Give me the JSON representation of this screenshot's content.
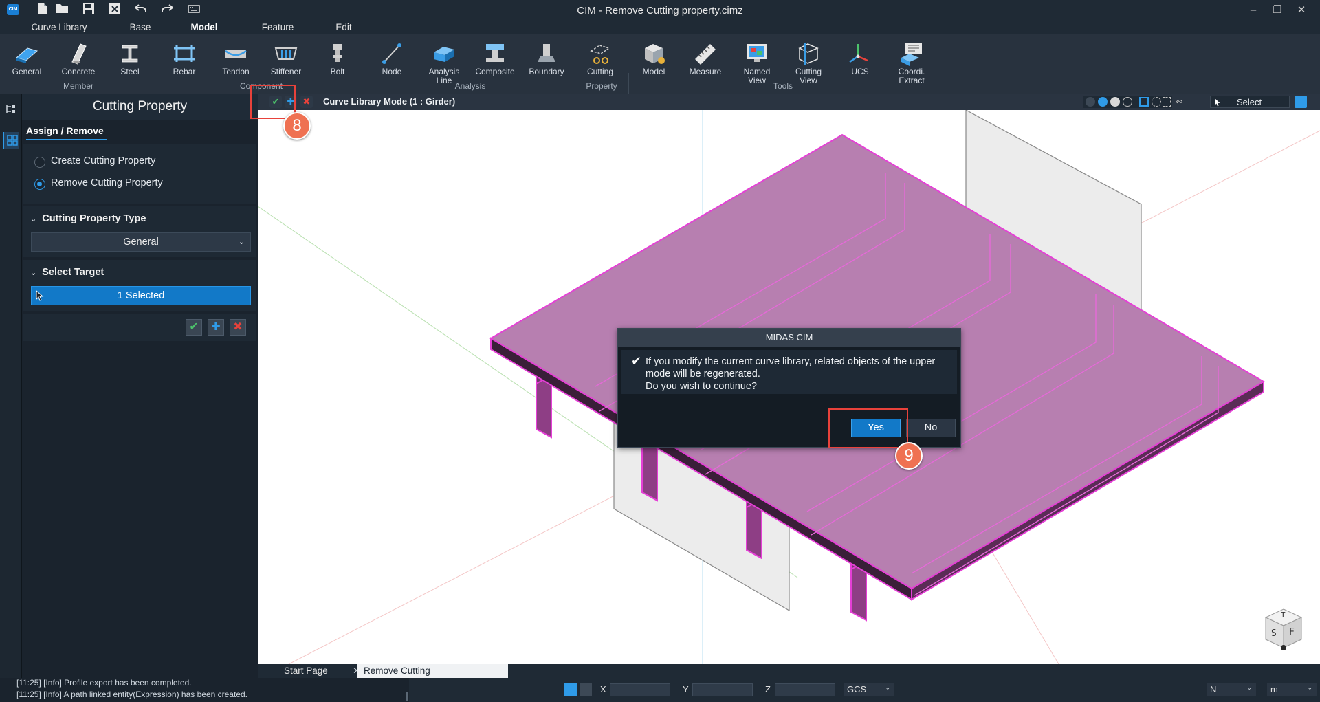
{
  "app": {
    "title": "CIM - Remove Cutting property.cimz",
    "logo_text": "CIM"
  },
  "quick_access": {
    "icons": [
      "new-file-icon",
      "open-folder-icon",
      "save-icon",
      "close-file-icon",
      "undo-icon",
      "redo-icon",
      "keyboard-icon"
    ]
  },
  "menu": {
    "tabs": [
      {
        "label": "Curve Library"
      },
      {
        "label": "Base"
      },
      {
        "label": "Model"
      },
      {
        "label": "Feature"
      },
      {
        "label": "Edit"
      }
    ],
    "active": "Model"
  },
  "ribbon": {
    "buttons": [
      {
        "label": "General",
        "icon": "plate-icon"
      },
      {
        "label": "Concrete",
        "icon": "concrete-icon"
      },
      {
        "label": "Steel",
        "icon": "steel-icon"
      },
      {
        "label": "Rebar",
        "icon": "rebar-icon"
      },
      {
        "label": "Tendon",
        "icon": "tendon-icon"
      },
      {
        "label": "Stiffener",
        "icon": "stiffener-icon"
      },
      {
        "label": "Bolt",
        "icon": "bolt-icon"
      },
      {
        "label": "Node",
        "icon": "node-icon"
      },
      {
        "label": "Analysis Line",
        "icon": "analysis-line-icon"
      },
      {
        "label": "Composite",
        "icon": "composite-icon"
      },
      {
        "label": "Boundary",
        "icon": "boundary-icon"
      },
      {
        "label": "Cutting",
        "icon": "cutting-icon"
      },
      {
        "label": "Model",
        "icon": "model-icon"
      },
      {
        "label": "Measure",
        "icon": "measure-icon"
      },
      {
        "label": "Named View",
        "icon": "named-view-icon"
      },
      {
        "label": "Cutting View",
        "icon": "cutting-view-icon"
      },
      {
        "label": "UCS",
        "icon": "ucs-icon"
      },
      {
        "label": "Coordi.",
        "icon": "coordinate-extract-icon"
      },
      {
        "label": "Extract",
        "icon": ""
      }
    ],
    "groups": [
      {
        "label": "Member"
      },
      {
        "label": "Component"
      },
      {
        "label": "Analysis"
      },
      {
        "label": "Property"
      },
      {
        "label": "Tools"
      }
    ]
  },
  "panel": {
    "title": "Cutting Property",
    "tab": "Assign / Remove",
    "options": [
      {
        "label": "Create Cutting Property",
        "selected": false
      },
      {
        "label": "Remove Cutting Property",
        "selected": true
      }
    ],
    "type_section": {
      "title": "Cutting Property Type",
      "value": "General"
    },
    "target_section": {
      "title": "Select Target",
      "button": "1 Selected"
    },
    "actions": [
      "apply",
      "add",
      "cancel"
    ]
  },
  "view": {
    "mode_label": "Curve Library Mode (1 : Girder)",
    "select_label": "Select"
  },
  "dialog": {
    "title": "MIDAS CIM",
    "message_lines": [
      "If you modify the current curve library, related objects of the upper",
      "mode will be regenerated.",
      "Do you wish to continue?"
    ],
    "yes": "Yes",
    "no": "No"
  },
  "callouts": [
    {
      "number": "8"
    },
    {
      "number": "9"
    }
  ],
  "doc_tabs": [
    {
      "label": "Start Page",
      "active": false
    },
    {
      "label": "Remove Cutting property.cimz",
      "active": true
    }
  ],
  "console": {
    "lines": [
      "[11:25] [Info] Profile export has been completed.",
      "[11:25] [Info] A path linked entity(Expression) has been created."
    ]
  },
  "status": {
    "x_label": "X",
    "y_label": "Y",
    "z_label": "Z",
    "coord_system": "GCS",
    "force_unit": "N",
    "length_unit": "m"
  },
  "view_cube": {
    "top": "T",
    "left": "S",
    "front": "F"
  },
  "colors": {
    "accent": "#2f9be8",
    "selection": "#e53fd6",
    "callout": "#ef7152",
    "highlight_box": "#e8423b"
  }
}
